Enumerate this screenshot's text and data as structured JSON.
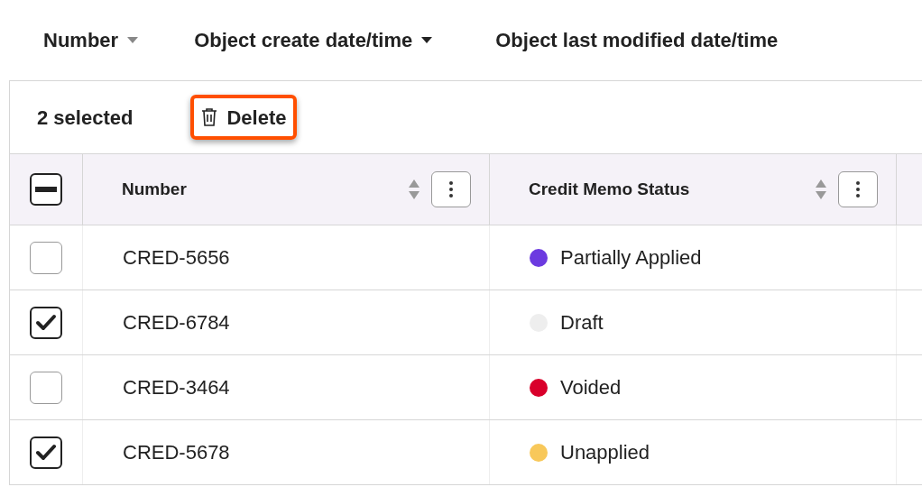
{
  "filters": [
    {
      "label": "Number",
      "caret": true,
      "caret_muted": true
    },
    {
      "label": "Object create date/time",
      "caret": true,
      "caret_muted": false
    },
    {
      "label": "Object last modified date/time",
      "caret": false
    }
  ],
  "toolbar": {
    "selected_count": "2 selected",
    "delete_label": "Delete",
    "highlighted": true
  },
  "table": {
    "select_all": {
      "indeterminate": true
    },
    "columns": [
      {
        "label": "Number"
      },
      {
        "label": "Credit Memo Status"
      }
    ],
    "rows": [
      {
        "checked": false,
        "number": "CRED-5656",
        "status": "Partially Applied",
        "color": "#6c3ae0"
      },
      {
        "checked": true,
        "number": "CRED-6784",
        "status": "Draft",
        "color": "#eeeeee"
      },
      {
        "checked": false,
        "number": "CRED-3464",
        "status": "Voided",
        "color": "#d9002b"
      },
      {
        "checked": true,
        "number": "CRED-5678",
        "status": "Unapplied",
        "color": "#f8c85a"
      }
    ]
  }
}
